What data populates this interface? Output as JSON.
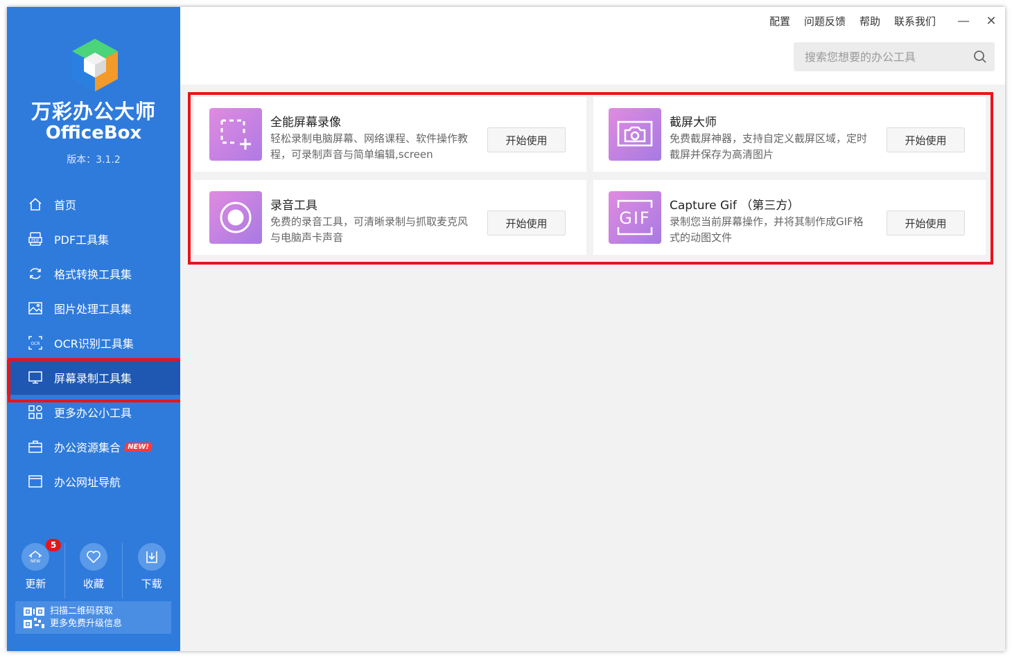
{
  "app": {
    "name_cn": "万彩办公大师",
    "name_en": "OfficeBox",
    "version": "版本：3.1.2"
  },
  "sidebar": {
    "items": [
      {
        "label": "首页",
        "icon": "home-icon"
      },
      {
        "label": "PDF工具集",
        "icon": "pdf-icon"
      },
      {
        "label": "格式转换工具集",
        "icon": "convert-icon"
      },
      {
        "label": "图片处理工具集",
        "icon": "image-icon"
      },
      {
        "label": "OCR识别工具集",
        "icon": "ocr-icon"
      },
      {
        "label": "屏幕录制工具集",
        "icon": "monitor-icon",
        "active": true
      },
      {
        "label": "更多办公小工具",
        "icon": "grid-icon"
      },
      {
        "label": "办公资源集合",
        "icon": "briefcase-icon",
        "badge": "NEW!"
      },
      {
        "label": "办公网址导航",
        "icon": "browser-icon"
      }
    ],
    "bottom_tools": [
      {
        "label": "更新",
        "icon": "update-icon",
        "badge": "5"
      },
      {
        "label": "收藏",
        "icon": "heart-icon"
      },
      {
        "label": "下载",
        "icon": "download-icon"
      }
    ],
    "qr": {
      "line1": "扫描二维码获取",
      "line2": "更多免费升级信息"
    }
  },
  "topbar": {
    "links": [
      "配置",
      "问题反馈",
      "帮助",
      "联系我们"
    ],
    "minimize": "—",
    "close": "✕",
    "search_placeholder": "搜索您想要的办公工具"
  },
  "tools": [
    {
      "title": "全能屏幕录像",
      "desc": "轻松录制电脑屏幕、网络课程、软件操作教程，可录制声音与简单编辑,screen",
      "button": "开始使用",
      "icon": "screen-record-icon"
    },
    {
      "title": "截屏大师",
      "desc": "免费截屏神器，支持自定义截屏区域，定时截屏并保存为高清图片",
      "button": "开始使用",
      "icon": "camera-icon"
    },
    {
      "title": "录音工具",
      "desc": "免费的录音工具，可清晰录制与抓取麦克风与电脑声卡声音",
      "button": "开始使用",
      "icon": "record-icon"
    },
    {
      "title": "Capture Gif （第三方）",
      "desc": "录制您当前屏幕操作，并将其制作成GIF格式的动图文件",
      "button": "开始使用",
      "icon": "gif-icon",
      "icon_text": "GIF"
    }
  ],
  "colors": {
    "sidebar_bg": "#2f7bdc",
    "sidebar_active": "#1f58b3",
    "highlight": "#e8141b",
    "card_icon_gradient_start": "#e08be0",
    "card_icon_gradient_end": "#9c6fe0"
  }
}
